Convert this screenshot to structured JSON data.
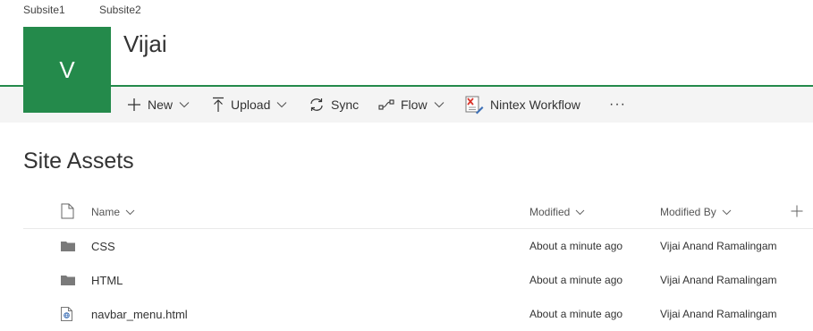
{
  "topnav": {
    "links": [
      "Subsite1",
      "Subsite2"
    ]
  },
  "site": {
    "logo_letter": "V",
    "title": "Vijai"
  },
  "commandbar": {
    "items": [
      {
        "label": "New",
        "icon": "plus-icon",
        "has_menu": true
      },
      {
        "label": "Upload",
        "icon": "upload-arrow-icon",
        "has_menu": true
      },
      {
        "label": "Sync",
        "icon": "sync-icon",
        "has_menu": false
      },
      {
        "label": "Flow",
        "icon": "flow-icon",
        "has_menu": true
      },
      {
        "label": "Nintex Workflow",
        "icon": "nintex-workflow-icon",
        "has_menu": false
      }
    ],
    "more_label": "···"
  },
  "library": {
    "title": "Site Assets",
    "columns": {
      "name": "Name",
      "modified": "Modified",
      "modified_by": "Modified By"
    },
    "rows": [
      {
        "type": "folder",
        "name": "CSS",
        "modified": "About a minute ago",
        "modified_by": "Vijai Anand Ramalingam"
      },
      {
        "type": "folder",
        "name": "HTML",
        "modified": "About a minute ago",
        "modified_by": "Vijai Anand Ramalingam"
      },
      {
        "type": "html-file",
        "name": "navbar_menu.html",
        "modified": "About a minute ago",
        "modified_by": "Vijai Anand Ramalingam"
      }
    ]
  },
  "colors": {
    "brand_green": "#248a4b",
    "command_bar_bg": "#f4f4f4",
    "text": "#333333"
  }
}
